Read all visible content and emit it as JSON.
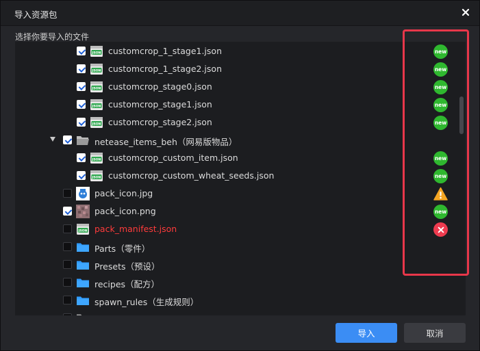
{
  "dialog": {
    "title": "导入资源包",
    "subtitle": "选择你要导入的文件"
  },
  "tree": [
    {
      "label": "customcrop_1_stage1.json",
      "type": "json",
      "checked": true,
      "indent": 2,
      "status": "new",
      "error": false
    },
    {
      "label": "customcrop_1_stage2.json",
      "type": "json",
      "checked": true,
      "indent": 2,
      "status": "new",
      "error": false
    },
    {
      "label": "customcrop_stage0.json",
      "type": "json",
      "checked": true,
      "indent": 2,
      "status": "new",
      "error": false
    },
    {
      "label": "customcrop_stage1.json",
      "type": "json",
      "checked": true,
      "indent": 2,
      "status": "new",
      "error": false
    },
    {
      "label": "customcrop_stage2.json",
      "type": "json",
      "checked": true,
      "indent": 2,
      "status": "new",
      "error": false
    },
    {
      "label": "netease_items_beh（网易版物品）",
      "type": "folder-open",
      "checked": true,
      "indent": 1,
      "expanded": true,
      "status": "",
      "error": false
    },
    {
      "label": "customcrop_custom_item.json",
      "type": "json",
      "checked": true,
      "indent": 2,
      "status": "new",
      "error": false
    },
    {
      "label": "customcrop_custom_wheat_seeds.json",
      "type": "json",
      "checked": true,
      "indent": 2,
      "status": "new",
      "error": false
    },
    {
      "label": "pack_icon.jpg",
      "type": "image-jpg",
      "checked": false,
      "indent": 0,
      "status": "warning",
      "error": false
    },
    {
      "label": "pack_icon.png",
      "type": "image-png",
      "checked": true,
      "indent": 0,
      "status": "new",
      "error": false
    },
    {
      "label": "pack_manifest.json",
      "type": "json",
      "checked": false,
      "indent": 0,
      "status": "error",
      "error": true
    },
    {
      "label": "Parts（零件）",
      "type": "folder",
      "checked": false,
      "indent": 0,
      "status": "",
      "error": false
    },
    {
      "label": "Presets（预设）",
      "type": "folder",
      "checked": false,
      "indent": 0,
      "status": "",
      "error": false
    },
    {
      "label": "recipes（配方）",
      "type": "folder",
      "checked": false,
      "indent": 0,
      "status": "",
      "error": false
    },
    {
      "label": "spawn_rules（生成规则）",
      "type": "folder",
      "checked": false,
      "indent": 0,
      "status": "",
      "error": false
    },
    {
      "label": "",
      "type": "folder-gray",
      "checked": false,
      "indent": 0,
      "status": "",
      "error": false
    }
  ],
  "badges": {
    "new_text": "new"
  },
  "buttons": {
    "import_label": "导入",
    "cancel_label": "取消"
  },
  "colors": {
    "accent": "#3b8df4",
    "new_badge": "#2fb82f",
    "error_badge": "#ee3b4f",
    "warning": "#f5a623",
    "error_text": "#ff3b3b",
    "highlight": "#e8374a",
    "folder": "#2e9bff"
  },
  "icons": {
    "close": "close-icon",
    "json": "json-file-icon",
    "folder": "folder-icon",
    "folder_open": "folder-open-icon",
    "image": "image-file-icon",
    "new": "new-badge-icon",
    "warning": "warning-icon",
    "error": "error-icon",
    "expander": "chevron-down-icon"
  }
}
